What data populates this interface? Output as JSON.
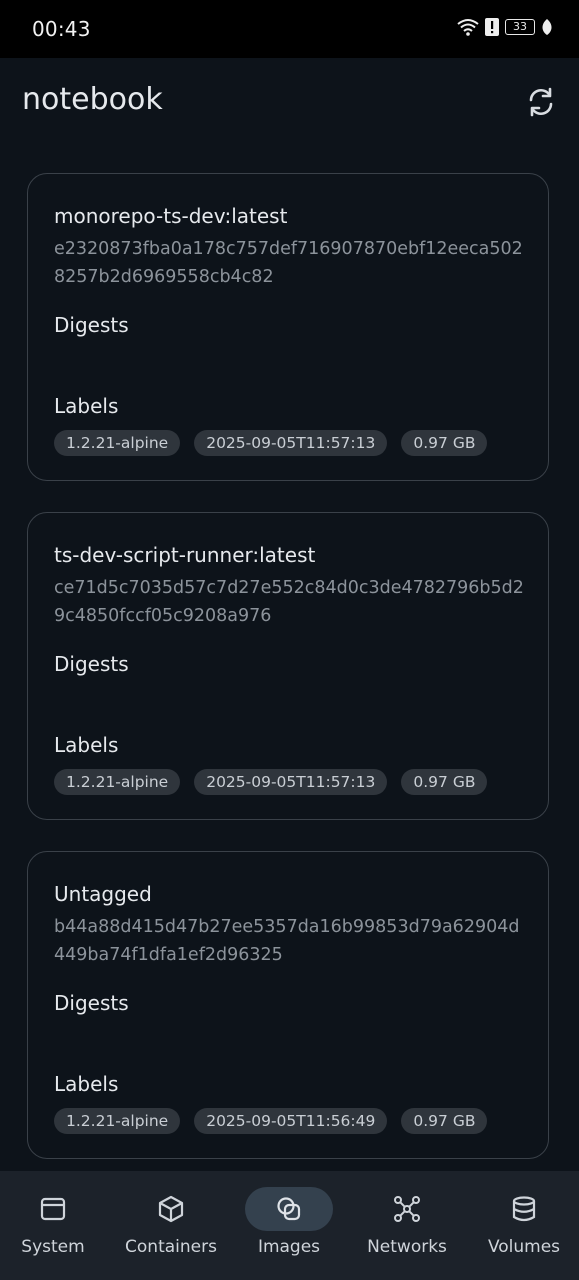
{
  "status_bar": {
    "time": "00:43",
    "battery": "33"
  },
  "header": {
    "title": "notebook",
    "refresh_icon": "refresh-icon"
  },
  "images": [
    {
      "name": "monorepo-ts-dev:latest",
      "hash": "e2320873fba0a178c757def716907870ebf12eeca5028257b2d6969558cb4c82",
      "digests_label": "Digests",
      "labels_label": "Labels",
      "chips": [
        "1.2.21-alpine",
        "2025-09-05T11:57:13",
        "0.97 GB"
      ]
    },
    {
      "name": "ts-dev-script-runner:latest",
      "hash": "ce71d5c7035d57c7d27e552c84d0c3de4782796b5d29c4850fccf05c9208a976",
      "digests_label": "Digests",
      "labels_label": "Labels",
      "chips": [
        "1.2.21-alpine",
        "2025-09-05T11:57:13",
        "0.97 GB"
      ]
    },
    {
      "name": "Untagged",
      "hash": "b44a88d415d47b27ee5357da16b99853d79a62904d449ba74f1dfa1ef2d96325",
      "digests_label": "Digests",
      "labels_label": "Labels",
      "chips": [
        "1.2.21-alpine",
        "2025-09-05T11:56:49",
        "0.97 GB"
      ]
    }
  ],
  "bottom_nav": {
    "active": "Images",
    "items": [
      {
        "label": "System",
        "icon": "window-icon"
      },
      {
        "label": "Containers",
        "icon": "cube-icon"
      },
      {
        "label": "Images",
        "icon": "images-icon"
      },
      {
        "label": "Networks",
        "icon": "network-icon"
      },
      {
        "label": "Volumes",
        "icon": "database-icon"
      }
    ]
  },
  "colors": {
    "background": "#0d131a",
    "card_border": "#3a4149",
    "chip_bg": "#2f353c",
    "nav_bg": "#1c222a",
    "active_pill": "#34414e"
  }
}
